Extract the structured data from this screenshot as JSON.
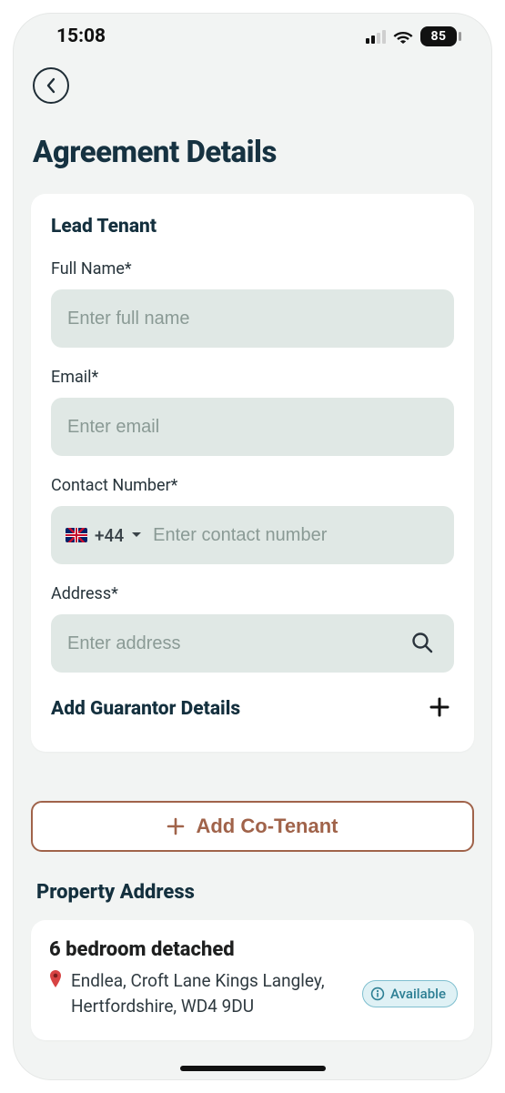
{
  "statusbar": {
    "time": "15:08",
    "battery": "85"
  },
  "page": {
    "title": "Agreement Details"
  },
  "lead_tenant": {
    "heading": "Lead Tenant",
    "full_name": {
      "label": "Full Name*",
      "placeholder": "Enter full name",
      "value": ""
    },
    "email": {
      "label": "Email*",
      "placeholder": "Enter email",
      "value": ""
    },
    "contact": {
      "label": "Contact Number*",
      "code": "+44",
      "placeholder": "Enter contact number",
      "value": ""
    },
    "address": {
      "label": "Address*",
      "placeholder": "Enter address",
      "value": ""
    },
    "add_guarantor_label": "Add Guarantor Details"
  },
  "co_tenant": {
    "button_label": "Add Co-Tenant"
  },
  "property": {
    "section_heading": "Property Address",
    "title": "6 bedroom detached",
    "address": "Endlea, Croft Lane Kings Langley, Hertfordshire, WD4 9DU",
    "status_label": "Available"
  }
}
